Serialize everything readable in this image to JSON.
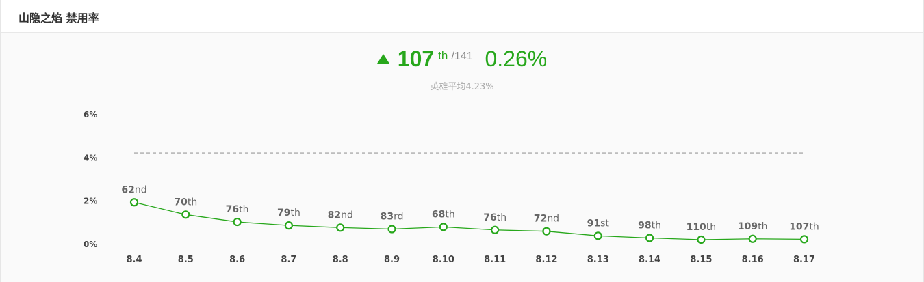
{
  "panel": {
    "title": "山隐之焰 禁用率"
  },
  "summary": {
    "trend_icon": "triangle-up-icon",
    "rank": "107",
    "rank_suffix": "th",
    "rank_total": "/141",
    "rate": "0.26%",
    "average_label": "英雄平均4.23%"
  },
  "colors": {
    "accent": "#27a71b",
    "average_line": "#999999",
    "background": "#fafafa"
  },
  "chart_data": {
    "type": "line",
    "title": "",
    "xlabel": "",
    "ylabel": "",
    "ylim": [
      0,
      6
    ],
    "y_ticks": [
      "0%",
      "2%",
      "4%",
      "6%"
    ],
    "categories": [
      "8.4",
      "8.5",
      "8.6",
      "8.7",
      "8.8",
      "8.9",
      "8.10",
      "8.11",
      "8.12",
      "8.13",
      "8.14",
      "8.15",
      "8.16",
      "8.17"
    ],
    "series": [
      {
        "values": [
          1.95,
          1.38,
          1.04,
          0.88,
          0.78,
          0.71,
          0.81,
          0.67,
          0.61,
          0.4,
          0.3,
          0.22,
          0.26,
          0.24
        ],
        "rank_labels": [
          {
            "num": "62",
            "suffix": "nd"
          },
          {
            "num": "70",
            "suffix": "th"
          },
          {
            "num": "76",
            "suffix": "th"
          },
          {
            "num": "79",
            "suffix": "th"
          },
          {
            "num": "82",
            "suffix": "nd"
          },
          {
            "num": "83",
            "suffix": "rd"
          },
          {
            "num": "68",
            "suffix": "th"
          },
          {
            "num": "76",
            "suffix": "th"
          },
          {
            "num": "72",
            "suffix": "nd"
          },
          {
            "num": "91",
            "suffix": "st"
          },
          {
            "num": "98",
            "suffix": "th"
          },
          {
            "num": "110",
            "suffix": "th"
          },
          {
            "num": "109",
            "suffix": "th"
          },
          {
            "num": "107",
            "suffix": "th"
          }
        ]
      }
    ],
    "average_line": 4.23,
    "grid": false,
    "legend": "none"
  }
}
